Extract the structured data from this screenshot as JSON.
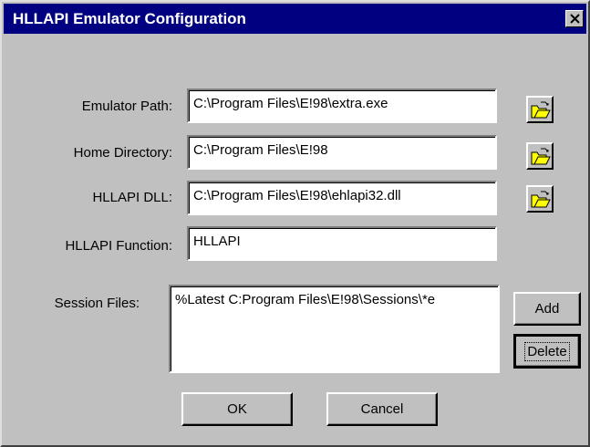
{
  "window": {
    "title": "HLLAPI Emulator Configuration",
    "close_icon": "close-x"
  },
  "fields": {
    "emulator_path": {
      "label": "Emulator Path:",
      "value": "C:\\Program Files\\E!98\\extra.exe"
    },
    "home_directory": {
      "label": "Home Directory:",
      "value": "C:\\Program Files\\E!98"
    },
    "hllapi_dll": {
      "label": "HLLAPI DLL:",
      "value": "C:\\Program Files\\E!98\\ehlapi32.dll"
    },
    "hllapi_function": {
      "label": "HLLAPI Function:",
      "value": "HLLAPI"
    },
    "session_files": {
      "label": "Session Files:",
      "value": "%Latest C:Program Files\\E!98\\Sessions\\*e"
    }
  },
  "buttons": {
    "add": "Add",
    "delete": "Delete",
    "ok": "OK",
    "cancel": "Cancel"
  },
  "icons": {
    "browse": "open-folder-icon"
  },
  "colors": {
    "titlebar": "#000080",
    "face": "#c0c0c0",
    "folder": "#ffff00"
  }
}
